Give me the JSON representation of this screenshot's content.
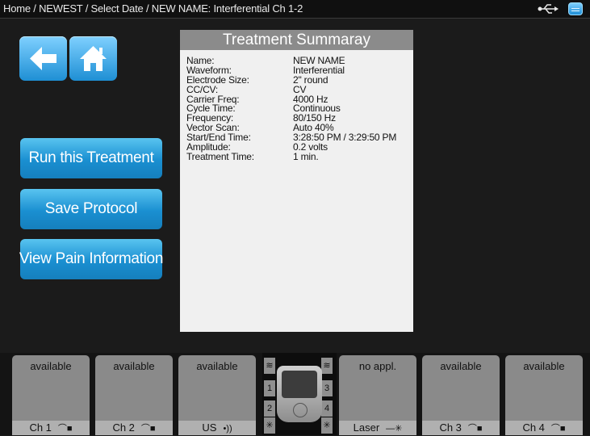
{
  "breadcrumb": "Home / NEWEST / Select Date / NEW NAME: Interferential Ch 1-2",
  "status_icons": [
    "usb-icon",
    "device-icon"
  ],
  "nav": {
    "back_icon": "back-arrow-icon",
    "home_icon": "home-icon"
  },
  "actions": {
    "run": "Run this Treatment",
    "save": "Save Protocol",
    "pain": "View Pain Information"
  },
  "summary": {
    "title": "Treatment Summaray",
    "rows": [
      {
        "label": "Name:",
        "value": "NEW NAME"
      },
      {
        "label": "Waveform:",
        "value": "Interferential"
      },
      {
        "label": "Electrode Size:",
        "value": "2\" round"
      },
      {
        "label": "CC/CV:",
        "value": "CV"
      },
      {
        "label": "Carrier Freq:",
        "value": "4000 Hz"
      },
      {
        "label": "Cycle Time:",
        "value": "Continuous"
      },
      {
        "label": "Frequency:",
        "value": "80/150 Hz"
      },
      {
        "label": "Vector Scan:",
        "value": "Auto 40%"
      },
      {
        "label": "Start/End Time:",
        "value": "3:28:50 PM / 3:29:50 PM"
      },
      {
        "label": "Amplitude:",
        "value": "0.2 volts"
      },
      {
        "label": "Treatment Time:",
        "value": "1 min."
      }
    ]
  },
  "channels": [
    {
      "status": "available",
      "label": "Ch 1",
      "icon": "electrode-icon"
    },
    {
      "status": "available",
      "label": "Ch 2",
      "icon": "electrode-icon"
    },
    {
      "status": "available",
      "label": "US",
      "icon": "ultrasound-icon"
    },
    {
      "status": "no appl.",
      "label": "Laser",
      "icon": "laser-icon"
    },
    {
      "status": "available",
      "label": "Ch 3",
      "icon": "electrode-icon"
    },
    {
      "status": "available",
      "label": "Ch 4",
      "icon": "electrode-icon"
    }
  ],
  "hub": {
    "left_slots": [
      "1",
      "2"
    ],
    "right_slots": [
      "3",
      "4"
    ]
  }
}
